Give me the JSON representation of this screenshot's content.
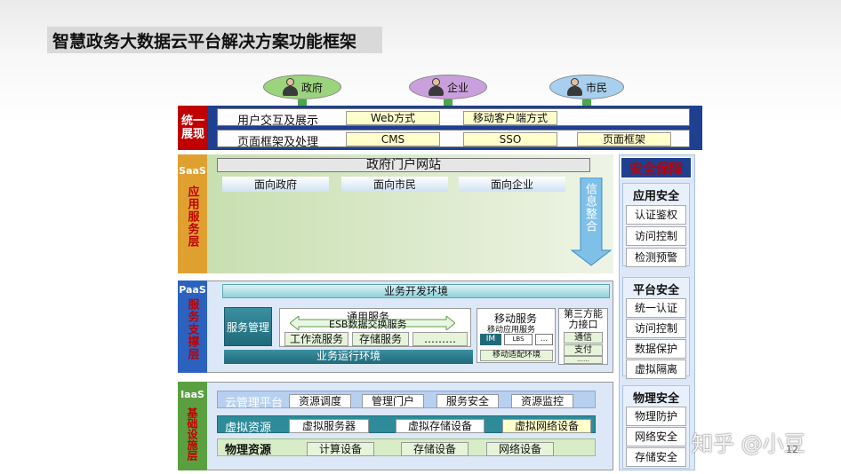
{
  "title": "智慧政务大数据云平台解决方案功能框架",
  "actors": [
    "政府",
    "企业",
    "市民"
  ],
  "display_layer": {
    "label": "统一展现",
    "row1": {
      "name": "用户交互及展示",
      "items": [
        "Web方式",
        "移动客户端方式"
      ]
    },
    "row2": {
      "name": "页面框架及处理",
      "items": [
        "CMS",
        "SSO",
        "页面框架"
      ]
    }
  },
  "saas": {
    "tag": "SaaS",
    "label": "应用服务层",
    "portal": "政府门户网站",
    "tabs": [
      "面向政府",
      "面向市民",
      "面向企业"
    ],
    "integration": "信息整合"
  },
  "paas": {
    "tag": "PaaS",
    "label": "服务支撑层",
    "dev_env": "业务开发环境",
    "service_mgmt": "服务管理",
    "general_service": "通用服务",
    "esb": "ESB数据交换服务",
    "workflow": "工作流服务",
    "storage": "存储服务",
    "ellipsis": "………",
    "runtime": "业务运行环境",
    "mobile_service": "移动服务",
    "mobile_app_service": "移动应用服务",
    "mobile_items": [
      "IM",
      "LBS",
      "..."
    ],
    "mobile_adapt": "移动适配环境",
    "third_party": "第三方能力接口",
    "third_items": [
      "通信",
      "支付",
      "……"
    ]
  },
  "iaas": {
    "tag": "IaaS",
    "label": "基础设施层",
    "rows": [
      {
        "name": "云管理平台",
        "items": [
          "资源调度",
          "管理门户",
          "服务安全",
          "资源监控"
        ]
      },
      {
        "name": "虚拟资源",
        "items": [
          "虚拟服务器",
          "虚拟存储设备",
          "虚拟网络设备"
        ]
      },
      {
        "name": "物理资源",
        "items": [
          "计算设备",
          "存储设备",
          "网络设备"
        ]
      }
    ]
  },
  "security": {
    "title": "安全保障",
    "groups": [
      {
        "name": "应用安全",
        "items": [
          "认证鉴权",
          "访问控制",
          "检测预警"
        ]
      },
      {
        "name": "平台安全",
        "items": [
          "统一认证",
          "访问控制",
          "数据保护",
          "虚拟隔离"
        ]
      },
      {
        "name": "物理安全",
        "items": [
          "物理防护",
          "网络安全",
          "存储安全"
        ]
      }
    ]
  },
  "watermark": "知乎 @小豆",
  "page_number": "12",
  "colors": {
    "navy": "#1f3f8f",
    "red": "#c00000",
    "green": "#5aa040",
    "paas_blue": "#2b62c0",
    "teal": "#2e8b9a"
  }
}
